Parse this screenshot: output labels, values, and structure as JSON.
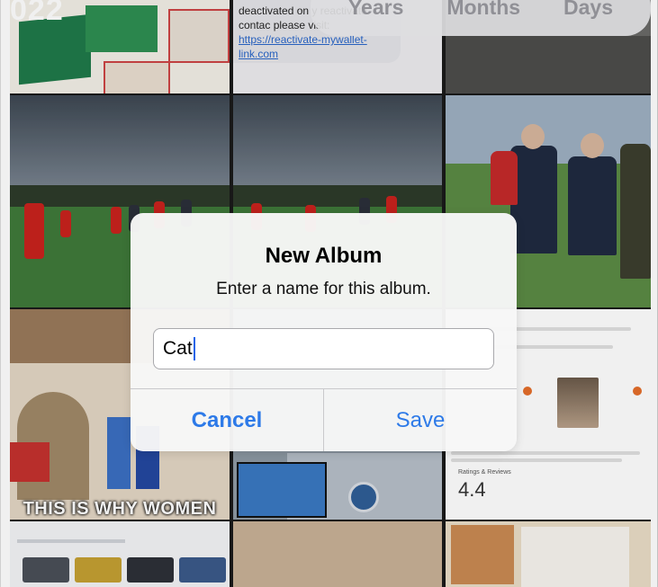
{
  "background": {
    "year_partial": "022",
    "message": {
      "text": "deactivated on y reactivate contac please visit:",
      "link": "https://reactivate-mywallet-link.com"
    },
    "meme_caption": "THIS IS WHY WOMEN",
    "store_rating": "4.4",
    "store_rating_label": "Ratings & Reviews"
  },
  "segment": {
    "items": [
      "Years",
      "Months",
      "Days"
    ]
  },
  "dialog": {
    "title": "New Album",
    "message": "Enter a name for this album.",
    "input_value": "Cat",
    "cancel_label": "Cancel",
    "save_label": "Save"
  },
  "colors": {
    "accent": "#2d7ae8",
    "caret": "#1c64e8"
  }
}
